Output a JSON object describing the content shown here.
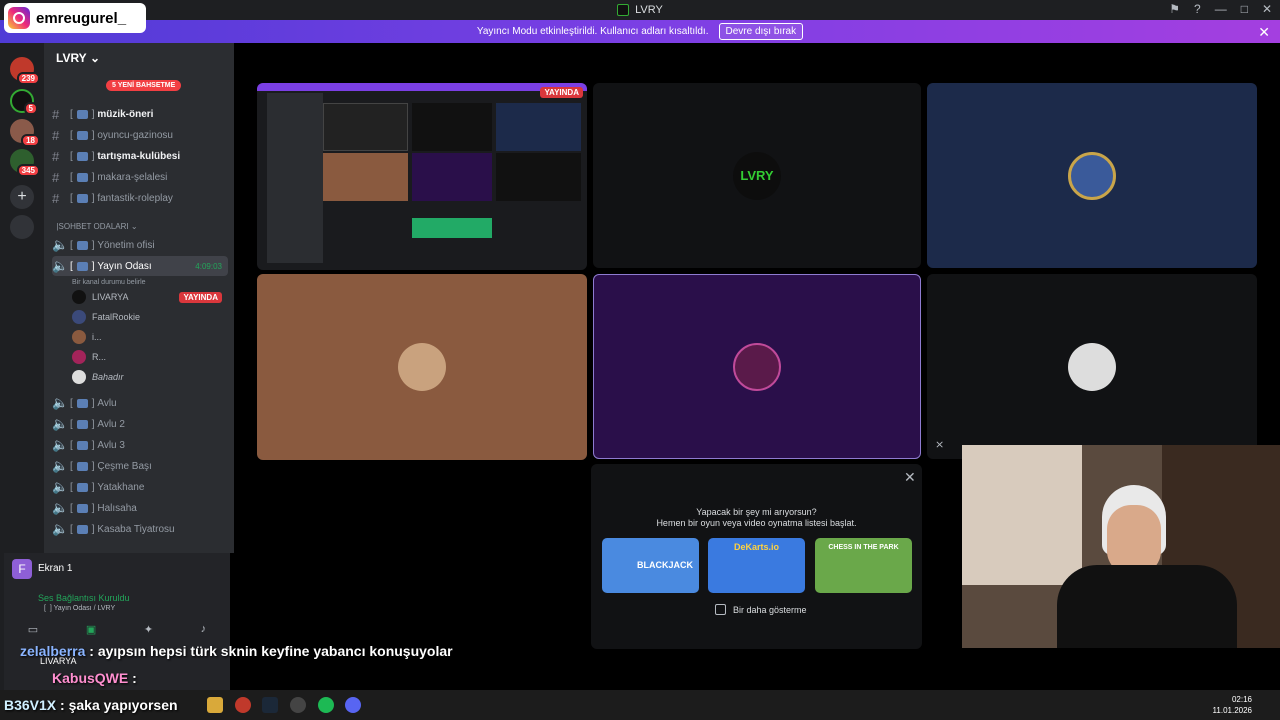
{
  "window": {
    "title": "LVRY",
    "controls": [
      "—",
      "□",
      "✕"
    ]
  },
  "instagram": {
    "handle": "emreugurel_"
  },
  "banner": {
    "text": "Yayıncı Modu etkinleştirildi. Kullanıcı adları kısaltıldı.",
    "button": "Devre dışı bırak"
  },
  "rail": {
    "badges": [
      "239",
      "5",
      "18",
      "345"
    ]
  },
  "sidebar": {
    "server_name": "LVRY",
    "new_badge": "5 YENİ BAHSETME",
    "channels": [
      {
        "label": "müzik-öneri",
        "bold": true
      },
      {
        "label": "oyuncu-gazinosu",
        "bold": false
      },
      {
        "label": "tartışma-kulübesi",
        "bold": true
      },
      {
        "label": "makara-şelalesi",
        "bold": false
      },
      {
        "label": "fantastik-roleplay",
        "bold": false
      }
    ],
    "category": "SOHBET ODALARI",
    "voice_channels": [
      {
        "label": "Yönetim ofisi"
      },
      {
        "label": "Yayın Odası",
        "timer": "4:09:03",
        "status": "Bir kanal durumu belirle"
      }
    ],
    "voice_users": [
      {
        "name": "LIVARYA",
        "live": "YAYINDA"
      },
      {
        "name": "FatalRookie"
      },
      {
        "name": "i..."
      },
      {
        "name": "R..."
      },
      {
        "name": "Bahadır"
      }
    ],
    "voice_channels_more": [
      "Avlu",
      "Avlu 2",
      "Avlu 3",
      "Çeşme Başı",
      "Yatakhane",
      "Halısaha",
      "Kasaba Tiyatrosu"
    ]
  },
  "voice_panel": {
    "screen_label": "Ekran 1",
    "status": "Ses Bağlantısı Kuruldu",
    "channel": "Yayın Odası",
    "server": "LVRY",
    "user": "LIVARYA"
  },
  "stream_tile": {
    "live_label": "YAYINDA"
  },
  "activity": {
    "line1": "Yapacak bir şey mi arıyorsun?",
    "line2": "Hemen bir oyun veya video oynatma listesi başlat.",
    "games": [
      "BLACKJACK",
      "DeKarts.io",
      "CHESS IN THE PARK"
    ],
    "dont_show": "Bir daha gösterme"
  },
  "chat": [
    {
      "name": "zelalberra",
      "text": ": ayıpsın hepsi türk sknin keyfine yabancı konuşuyolar"
    },
    {
      "name": "KabusQWE",
      "text": ":"
    },
    {
      "name": "B36V1X",
      "text": ": şaka yapıyorsen"
    }
  ],
  "taskbar": {
    "time": "02:16",
    "date": "11.01.2026"
  }
}
